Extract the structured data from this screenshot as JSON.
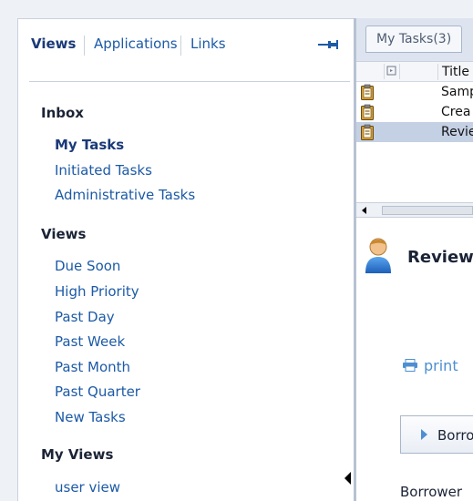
{
  "nav_tabs": {
    "views": "Views",
    "applications": "Applications",
    "links": "Links"
  },
  "sections": {
    "inbox": {
      "title": "Inbox",
      "items": [
        "My Tasks",
        "Initiated Tasks",
        "Administrative Tasks"
      ]
    },
    "views": {
      "title": "Views",
      "items": [
        "Due Soon",
        "High Priority",
        "Past Day",
        "Past Week",
        "Past Month",
        "Past Quarter",
        "New Tasks"
      ]
    },
    "my_views": {
      "title": "My Views",
      "items": [
        "user view"
      ]
    }
  },
  "right": {
    "tab_label": "My Tasks(3)",
    "column_title": "Title",
    "tasks": [
      {
        "title": "Samp",
        "selected": false
      },
      {
        "title": "Crea",
        "selected": false
      },
      {
        "title": "Revie",
        "selected": true
      }
    ],
    "detail_title": "Review",
    "print_label": "print",
    "borrower_section": "Borro",
    "borrower_label": "Borrower"
  },
  "icons": {
    "pin": "pin-icon",
    "task": "clipboard-icon",
    "user": "user-icon",
    "print": "printer-icon"
  },
  "colors": {
    "link": "#1c5aa6",
    "selected_row": "#c4d0e3",
    "print_link": "#4d8fd1"
  }
}
